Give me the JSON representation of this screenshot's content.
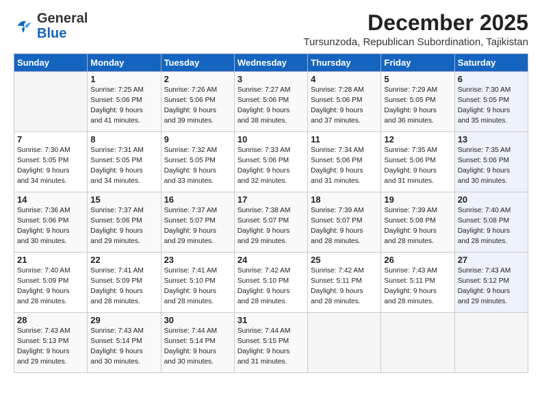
{
  "logo": {
    "general": "General",
    "blue": "Blue"
  },
  "header": {
    "month": "December 2025",
    "location": "Tursunzoda, Republican Subordination, Tajikistan"
  },
  "weekdays": [
    "Sunday",
    "Monday",
    "Tuesday",
    "Wednesday",
    "Thursday",
    "Friday",
    "Saturday"
  ],
  "weeks": [
    [
      {
        "day": "",
        "info": ""
      },
      {
        "day": "1",
        "info": "Sunrise: 7:25 AM\nSunset: 5:06 PM\nDaylight: 9 hours\nand 41 minutes."
      },
      {
        "day": "2",
        "info": "Sunrise: 7:26 AM\nSunset: 5:06 PM\nDaylight: 9 hours\nand 39 minutes."
      },
      {
        "day": "3",
        "info": "Sunrise: 7:27 AM\nSunset: 5:06 PM\nDaylight: 9 hours\nand 38 minutes."
      },
      {
        "day": "4",
        "info": "Sunrise: 7:28 AM\nSunset: 5:06 PM\nDaylight: 9 hours\nand 37 minutes."
      },
      {
        "day": "5",
        "info": "Sunrise: 7:29 AM\nSunset: 5:05 PM\nDaylight: 9 hours\nand 36 minutes."
      },
      {
        "day": "6",
        "info": "Sunrise: 7:30 AM\nSunset: 5:05 PM\nDaylight: 9 hours\nand 35 minutes."
      }
    ],
    [
      {
        "day": "7",
        "info": "Sunrise: 7:30 AM\nSunset: 5:05 PM\nDaylight: 9 hours\nand 34 minutes."
      },
      {
        "day": "8",
        "info": "Sunrise: 7:31 AM\nSunset: 5:05 PM\nDaylight: 9 hours\nand 34 minutes."
      },
      {
        "day": "9",
        "info": "Sunrise: 7:32 AM\nSunset: 5:05 PM\nDaylight: 9 hours\nand 33 minutes."
      },
      {
        "day": "10",
        "info": "Sunrise: 7:33 AM\nSunset: 5:06 PM\nDaylight: 9 hours\nand 32 minutes."
      },
      {
        "day": "11",
        "info": "Sunrise: 7:34 AM\nSunset: 5:06 PM\nDaylight: 9 hours\nand 31 minutes."
      },
      {
        "day": "12",
        "info": "Sunrise: 7:35 AM\nSunset: 5:06 PM\nDaylight: 9 hours\nand 31 minutes."
      },
      {
        "day": "13",
        "info": "Sunrise: 7:35 AM\nSunset: 5:06 PM\nDaylight: 9 hours\nand 30 minutes."
      }
    ],
    [
      {
        "day": "14",
        "info": "Sunrise: 7:36 AM\nSunset: 5:06 PM\nDaylight: 9 hours\nand 30 minutes."
      },
      {
        "day": "15",
        "info": "Sunrise: 7:37 AM\nSunset: 5:06 PM\nDaylight: 9 hours\nand 29 minutes."
      },
      {
        "day": "16",
        "info": "Sunrise: 7:37 AM\nSunset: 5:07 PM\nDaylight: 9 hours\nand 29 minutes."
      },
      {
        "day": "17",
        "info": "Sunrise: 7:38 AM\nSunset: 5:07 PM\nDaylight: 9 hours\nand 29 minutes."
      },
      {
        "day": "18",
        "info": "Sunrise: 7:39 AM\nSunset: 5:07 PM\nDaylight: 9 hours\nand 28 minutes."
      },
      {
        "day": "19",
        "info": "Sunrise: 7:39 AM\nSunset: 5:08 PM\nDaylight: 9 hours\nand 28 minutes."
      },
      {
        "day": "20",
        "info": "Sunrise: 7:40 AM\nSunset: 5:08 PM\nDaylight: 9 hours\nand 28 minutes."
      }
    ],
    [
      {
        "day": "21",
        "info": "Sunrise: 7:40 AM\nSunset: 5:09 PM\nDaylight: 9 hours\nand 28 minutes."
      },
      {
        "day": "22",
        "info": "Sunrise: 7:41 AM\nSunset: 5:09 PM\nDaylight: 9 hours\nand 28 minutes."
      },
      {
        "day": "23",
        "info": "Sunrise: 7:41 AM\nSunset: 5:10 PM\nDaylight: 9 hours\nand 28 minutes."
      },
      {
        "day": "24",
        "info": "Sunrise: 7:42 AM\nSunset: 5:10 PM\nDaylight: 9 hours\nand 28 minutes."
      },
      {
        "day": "25",
        "info": "Sunrise: 7:42 AM\nSunset: 5:11 PM\nDaylight: 9 hours\nand 28 minutes."
      },
      {
        "day": "26",
        "info": "Sunrise: 7:43 AM\nSunset: 5:11 PM\nDaylight: 9 hours\nand 28 minutes."
      },
      {
        "day": "27",
        "info": "Sunrise: 7:43 AM\nSunset: 5:12 PM\nDaylight: 9 hours\nand 29 minutes."
      }
    ],
    [
      {
        "day": "28",
        "info": "Sunrise: 7:43 AM\nSunset: 5:13 PM\nDaylight: 9 hours\nand 29 minutes."
      },
      {
        "day": "29",
        "info": "Sunrise: 7:43 AM\nSunset: 5:14 PM\nDaylight: 9 hours\nand 30 minutes."
      },
      {
        "day": "30",
        "info": "Sunrise: 7:44 AM\nSunset: 5:14 PM\nDaylight: 9 hours\nand 30 minutes."
      },
      {
        "day": "31",
        "info": "Sunrise: 7:44 AM\nSunset: 5:15 PM\nDaylight: 9 hours\nand 31 minutes."
      },
      {
        "day": "",
        "info": ""
      },
      {
        "day": "",
        "info": ""
      },
      {
        "day": "",
        "info": ""
      }
    ]
  ]
}
